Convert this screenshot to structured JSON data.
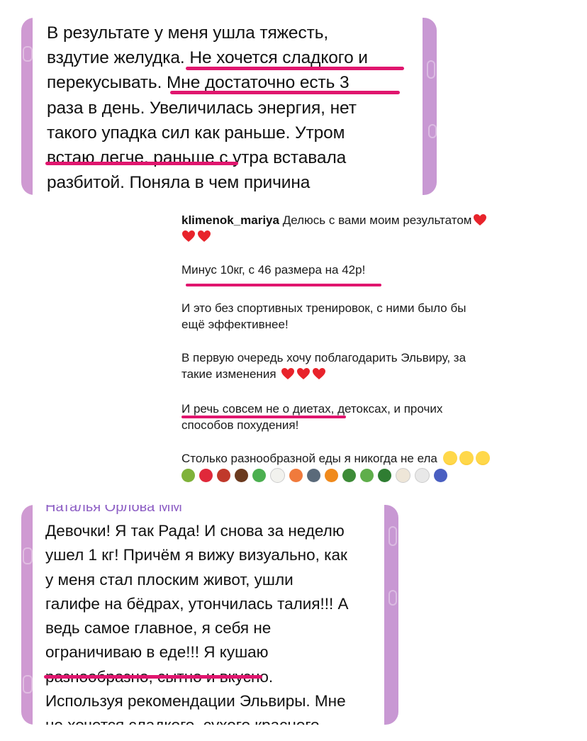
{
  "card_top": {
    "lines": [
      "В результате у меня ушла тяжесть,",
      "вздутие желудка. Не хочется сладкого и",
      "перекусывать. Мне достаточно есть 3",
      "раза в день. Увеличилась энергия, нет",
      "такого упадка сил как раньше. Утром",
      "встаю легче, раньше с утра вставала",
      "разбитой. Поняла в чем причина"
    ],
    "highlight_color": "#e0166e"
  },
  "card_middle": {
    "username": "klimenok_mariya",
    "intro": "Делюсь с вами моим результатом",
    "result_line": "Минус 10кг, с 46 размера на 42р!",
    "p2": [
      "И это без спортивных тренировок, с ними  было бы",
      "ещё эффективнее!"
    ],
    "p3": [
      "В первую очередь хочу поблагодарить Эльвиру, за",
      "такие изменения"
    ],
    "p4": [
      "И речь совсем не о диетах, детоксах, и прочих",
      "способов похудения!"
    ],
    "p5": "Столько разнообразной еды я никогда не ела",
    "food_emojis": [
      "avocado",
      "strawberry",
      "meat",
      "coconut",
      "salad",
      "egg",
      "shrimp",
      "magnifier",
      "carrot",
      "greens",
      "herb",
      "broccoli",
      "garlic",
      "onion",
      "blueberries"
    ]
  },
  "card_bottom": {
    "author": "Наталья Орлова ММ",
    "lines": [
      "Девочки! Я так Рада! И снова за неделю",
      "ушел 1 кг! Причём я вижу визуально, как",
      "у меня стал плоским живот, ушли",
      "галифе на бёдрах, утончилась талия!!! А",
      "ведь самое главное, я себя не",
      "ограничиваю в еде!!! Я кушаю",
      "разнообразно, сытно и вкусно.",
      "Используя рекомендации Эльвиры. Мне",
      "не хочется сладкого, сухого красного"
    ]
  },
  "colors": {
    "accent": "#e0166e",
    "side_strip": "#cf9ad2",
    "author_name": "#8c5dc4"
  }
}
